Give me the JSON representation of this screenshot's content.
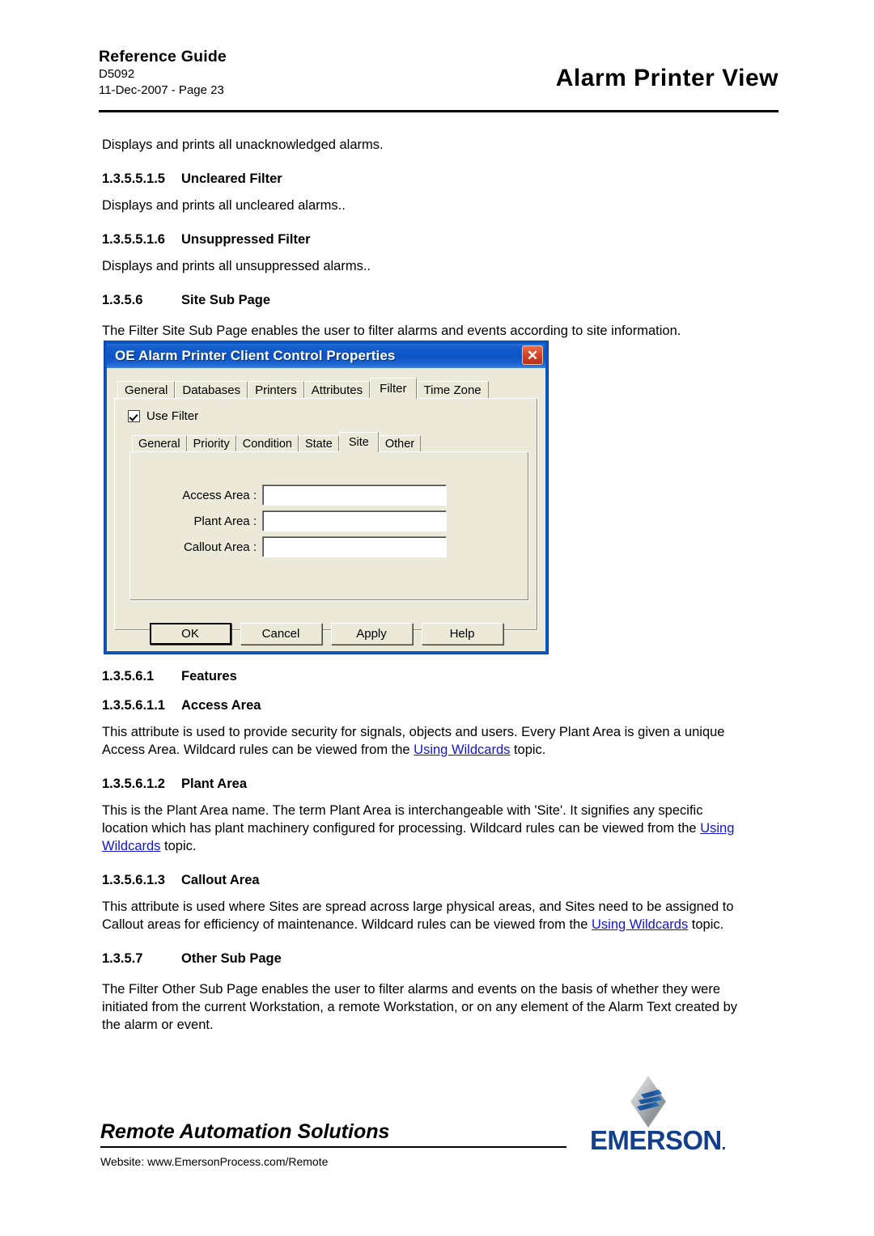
{
  "header": {
    "reference_guide": "Reference Guide",
    "doc_number": "D5092",
    "date_page": "11-Dec-2007 - Page 23",
    "title": "Alarm Printer View"
  },
  "content": {
    "intro_paragraph": "Displays and prints all unacknowledged alarms.",
    "sections": [
      {
        "number": "1.3.5.5.1.5",
        "title": "Uncleared Filter",
        "body": "Displays and prints all uncleared alarms.."
      },
      {
        "number": "1.3.5.5.1.6",
        "title": "Unsuppressed Filter",
        "body": "Displays and prints all unsuppressed alarms.."
      },
      {
        "number": "1.3.5.6",
        "title": "Site Sub Page",
        "body": "The Filter Site Sub Page enables the user to filter alarms and events according to site information."
      }
    ],
    "features_heading": {
      "number": "1.3.5.6.1",
      "title": "Features"
    },
    "access_area": {
      "number": "1.3.5.6.1.1",
      "title": "Access Area",
      "body_part1": "This attribute is used to provide security for signals, objects and users. Every Plant Area is given a unique Access Area. Wildcard rules can be viewed from the ",
      "link": "Using Wildcards",
      "body_part2": " topic."
    },
    "plant_area": {
      "number": "1.3.5.6.1.2",
      "title": "Plant Area",
      "body_part1": "This is the Plant Area name. The term Plant Area is interchangeable with 'Site'. It signifies any specific location which has plant machinery configured for processing. Wildcard rules can be viewed from the ",
      "link": "Using Wildcards",
      "body_part2": " topic."
    },
    "callout_area": {
      "number": "1.3.5.6.1.3",
      "title": "Callout Area",
      "body_part1": "This attribute is used where Sites are spread across large physical areas, and Sites need to be assigned to Callout areas for efficiency of maintenance. Wildcard rules can be viewed from the ",
      "link": "Using Wildcards",
      "body_part2": " topic."
    },
    "other_sub_page": {
      "number": "1.3.5.7",
      "title": "Other Sub Page",
      "body": "The Filter Other Sub Page enables the user to filter alarms and events on the basis of whether they were initiated from the current Workstation, a remote Workstation, or on any element of the Alarm Text created by the alarm or event."
    }
  },
  "dialog": {
    "title": "OE Alarm Printer Client Control Properties",
    "close_icon": "close-icon",
    "outer_tabs": [
      {
        "label": "General",
        "active": false
      },
      {
        "label": "Databases",
        "active": false
      },
      {
        "label": "Printers",
        "active": false
      },
      {
        "label": "Attributes",
        "active": false
      },
      {
        "label": "Filter",
        "active": true
      },
      {
        "label": "Time Zone",
        "active": false
      }
    ],
    "use_filter": {
      "label": "Use Filter",
      "checked": true
    },
    "inner_tabs": [
      {
        "label": "General",
        "active": false
      },
      {
        "label": "Priority",
        "active": false
      },
      {
        "label": "Condition",
        "active": false
      },
      {
        "label": "State",
        "active": false
      },
      {
        "label": "Site",
        "active": true
      },
      {
        "label": "Other",
        "active": false
      }
    ],
    "fields": [
      {
        "label": "Access Area :",
        "value": ""
      },
      {
        "label": "Plant Area :",
        "value": ""
      },
      {
        "label": "Callout Area :",
        "value": ""
      }
    ],
    "buttons": [
      {
        "label": "OK",
        "default": true
      },
      {
        "label": "Cancel",
        "default": false
      },
      {
        "label": "Apply",
        "default": false
      },
      {
        "label": "Help",
        "default": false
      }
    ]
  },
  "footer": {
    "brand_line": "Remote Automation Solutions",
    "website": "Website:  www.EmersonProcess.com/Remote",
    "logo_text": "EMERSON",
    "logo_dot": "."
  },
  "colors": {
    "link": "#1414d6",
    "titlebar_blue": "#0d53c6",
    "dialog_face": "#ece9d8",
    "close_red": "#d8472a",
    "emerson_blue": "#12408e"
  }
}
